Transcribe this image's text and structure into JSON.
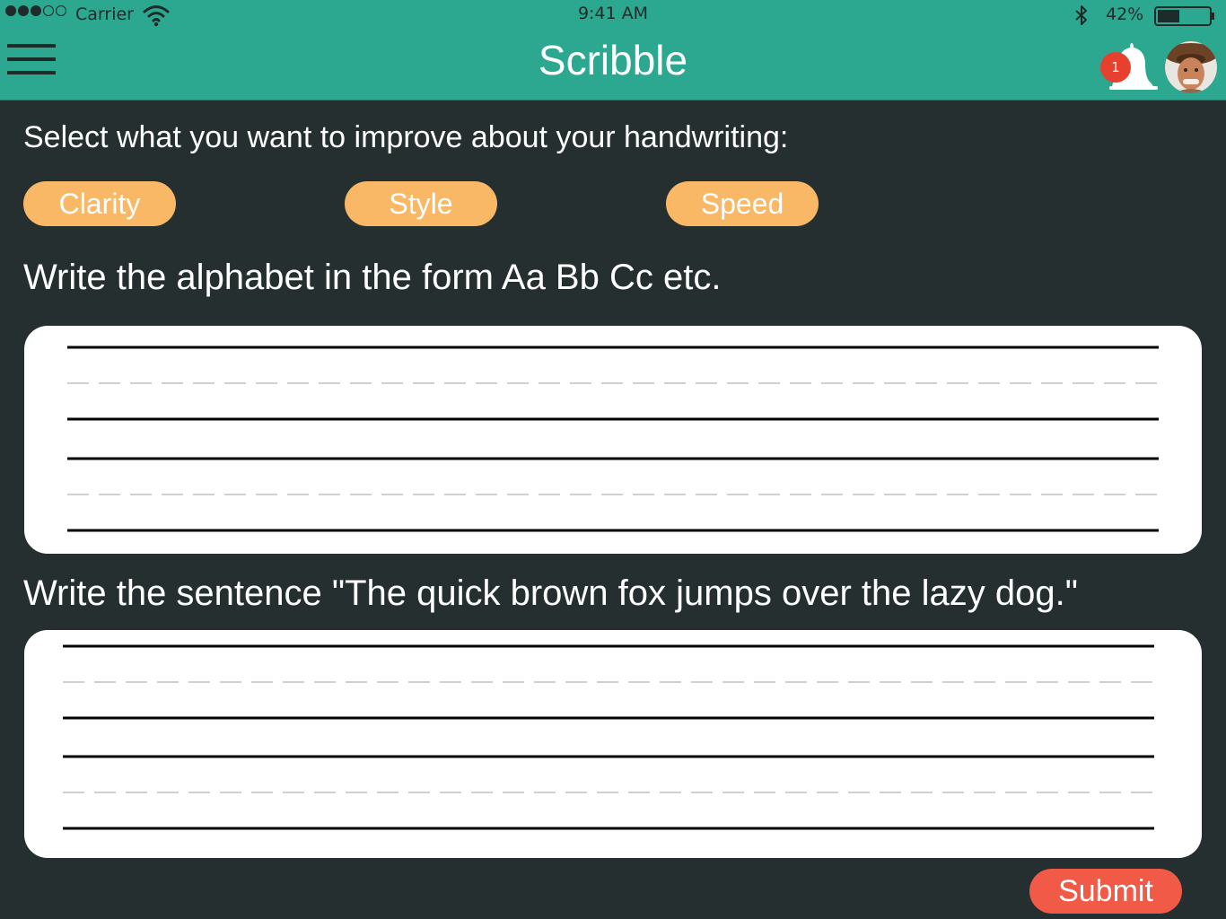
{
  "status_bar": {
    "carrier": "Carrier",
    "time": "9:41 AM",
    "battery": "42%",
    "signal_icon": "signal-dots-icon",
    "wifi_icon": "wifi-icon",
    "bluetooth_icon": "bluetooth-icon",
    "battery_icon": "battery-icon",
    "battery_level": 0.42
  },
  "header": {
    "title": "Scribble",
    "menu_icon": "hamburger-menu-icon",
    "notification_icon": "bell-icon",
    "notification_count": "1",
    "color": "#2ba88f"
  },
  "main": {
    "select_prompt": "Select what you want to improve about your handwriting:",
    "options": [
      {
        "label": "Clarity"
      },
      {
        "label": "Style"
      },
      {
        "label": "Speed"
      }
    ],
    "alphabet_prompt": "Write the alphabet in the form Aa Bb Cc etc.",
    "sentence_prompt": "Write the sentence \"The quick brown fox jumps over the lazy dog.\"",
    "submit_label": "Submit"
  },
  "colors": {
    "background": "#252f2f",
    "accent": "#2ba88f",
    "option": "#f8b866",
    "submit": "#f05a46",
    "badge": "#e8402e"
  }
}
